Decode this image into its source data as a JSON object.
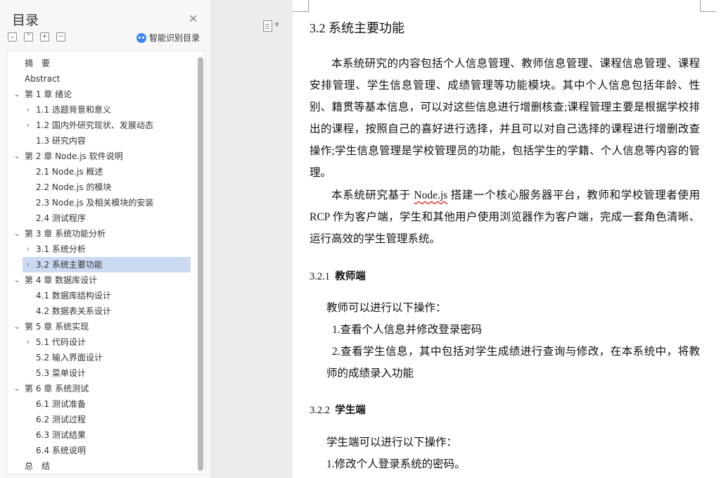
{
  "toc": {
    "title": "目录",
    "smart_toc_label": "智能识别目录",
    "tools": [
      "expand-all",
      "collapse-all",
      "add-heading",
      "remove-heading"
    ],
    "active_index": 16,
    "items": [
      {
        "label": "摘　要",
        "level": 0,
        "toggle": "none"
      },
      {
        "label": "Abstract",
        "level": 0,
        "toggle": "none"
      },
      {
        "label": "第 1 章  绪论",
        "level": 0,
        "toggle": "expanded"
      },
      {
        "label": "1.1 选题背景和意义",
        "level": 1,
        "toggle": "collapsed"
      },
      {
        "label": "1.2 国内外研究现状、发展动态",
        "level": 1,
        "toggle": "collapsed"
      },
      {
        "label": "1.3 研究内容",
        "level": 1,
        "toggle": "none"
      },
      {
        "label": "第 2 章  Node.js 软件说明",
        "level": 0,
        "toggle": "expanded"
      },
      {
        "label": "2.1 Node.js 概述",
        "level": 1,
        "toggle": "none"
      },
      {
        "label": "2.2 Node.js 的模块",
        "level": 1,
        "toggle": "none"
      },
      {
        "label": "2.3 Node.js 及相关模块的安装",
        "level": 1,
        "toggle": "none"
      },
      {
        "label": "2.4  测试程序",
        "level": 1,
        "toggle": "none"
      },
      {
        "label": "第 3 章  系统功能分析",
        "level": 0,
        "toggle": "expanded"
      },
      {
        "label": "3.1 系统分析",
        "level": 1,
        "toggle": "collapsed"
      },
      {
        "label": "3.2 系统主要功能",
        "level": 1,
        "toggle": "collapsed"
      },
      {
        "label": "第 4 章  数据库设计",
        "level": 0,
        "toggle": "expanded"
      },
      {
        "label": "4.1 数据库结构设计",
        "level": 1,
        "toggle": "none"
      },
      {
        "label": "4.2 数据表关系设计",
        "level": 1,
        "toggle": "none"
      },
      {
        "label": "第 5 章  系统实现",
        "level": 0,
        "toggle": "expanded"
      },
      {
        "label": "5.1 代码设计",
        "level": 1,
        "toggle": "collapsed"
      },
      {
        "label": "5.2 输入界面设计",
        "level": 1,
        "toggle": "none"
      },
      {
        "label": "5.3 菜单设计",
        "level": 1,
        "toggle": "none"
      },
      {
        "label": "第 6 章  系统测试",
        "level": 0,
        "toggle": "expanded"
      },
      {
        "label": "6.1 测试准备",
        "level": 1,
        "toggle": "none"
      },
      {
        "label": "6.2 测试过程",
        "level": 1,
        "toggle": "none"
      },
      {
        "label": "6.3 测试结果",
        "level": 1,
        "toggle": "none"
      },
      {
        "label": "6.4 系统说明",
        "level": 1,
        "toggle": "none"
      },
      {
        "label": "总　结",
        "level": 0,
        "toggle": "none"
      }
    ],
    "active_label_index": 13
  },
  "doc": {
    "heading": "3.2 系统主要功能",
    "para1": "本系统研究的内容包括个人信息管理、教师信息管理、课程信息管理、课程安排管理、学生信息管理、成绩管理等功能模块。其中个人信息包括年龄、性别、籍贯等基本信息，可以对这些信息进行增删核查;课程管理主要是根据学校排出的课程，按照自己的喜好进行选择，并且可以对自己选择的课程进行增删改查操作;学生信息管理是学校管理员的功能，包括学生的学籍、个人信息等内容的管理。",
    "para2_a": "本系统研究基于 ",
    "para2_nodejs": "Node.js",
    "para2_b": " 搭建一个核心服务器平台，教师和学校管理者使用 RCP 作为客户端，学生和其他用户使用浏览器作为客户端，完成一套角色清晰、运行高效的学生管理系统。",
    "sec1_num": "3.2.1",
    "sec1_title": "教师端",
    "sec1_intro": "教师可以进行以下操作：",
    "sec1_item1": "1.查看个人信息并修改登录密码",
    "sec1_item2": "2.查看学生信息，其中包括对学生成绩进行查询与修改，在本系统中，将教师的成绩录入功能",
    "sec2_num": "3.2.2",
    "sec2_title": "学生端",
    "sec2_intro": "学生端可以进行以下操作：",
    "sec2_item1": "1.修改个人登录系统的密码。"
  },
  "colors": {
    "active_item_bg": "#cbdaf3",
    "smart_icon": "#3f87f5",
    "spell_underline": "#e04040"
  }
}
